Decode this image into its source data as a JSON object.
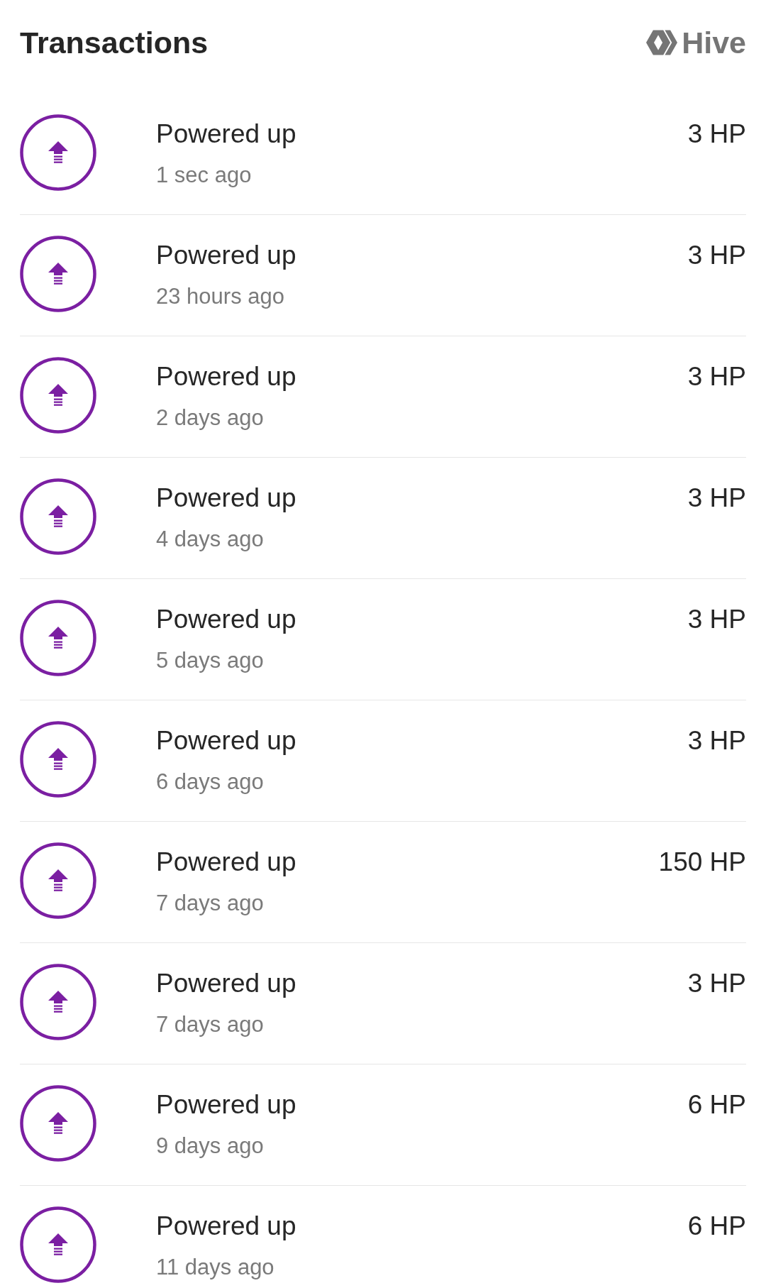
{
  "header": {
    "title": "Transactions",
    "brand": "Hive"
  },
  "transactions": [
    {
      "title": "Powered up",
      "time": "1 sec ago",
      "amount": "3 HP"
    },
    {
      "title": "Powered up",
      "time": "23 hours ago",
      "amount": "3 HP"
    },
    {
      "title": "Powered up",
      "time": "2 days ago",
      "amount": "3 HP"
    },
    {
      "title": "Powered up",
      "time": "4 days ago",
      "amount": "3 HP"
    },
    {
      "title": "Powered up",
      "time": "5 days ago",
      "amount": "3 HP"
    },
    {
      "title": "Powered up",
      "time": "6 days ago",
      "amount": "3 HP"
    },
    {
      "title": "Powered up",
      "time": "7 days ago",
      "amount": "150 HP"
    },
    {
      "title": "Powered up",
      "time": "7 days ago",
      "amount": "3 HP"
    },
    {
      "title": "Powered up",
      "time": "9 days ago",
      "amount": "6 HP"
    },
    {
      "title": "Powered up",
      "time": "11 days ago",
      "amount": "6 HP"
    }
  ]
}
